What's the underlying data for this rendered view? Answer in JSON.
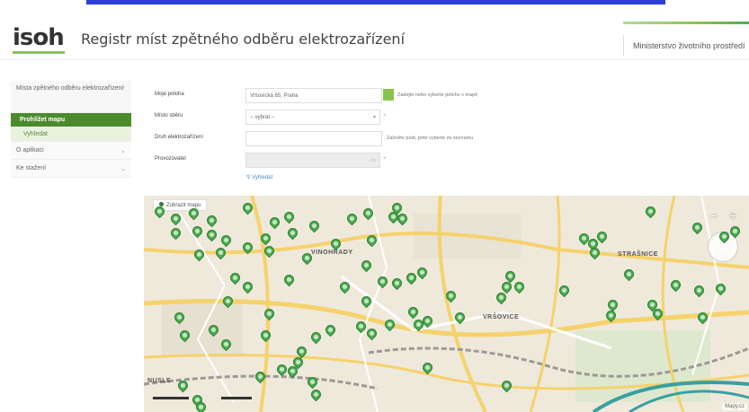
{
  "header": {
    "logo": "isoh",
    "title": "Registr míst zpětného odběru elektrozařízení",
    "ministry": "Ministerstvo životního prostředí"
  },
  "sidebar": {
    "group_label": "Místa zpětného odběru elektrozařízení",
    "active_item": "Prohlížet mapu",
    "sub_item": "Vyhledat",
    "item_2": "O aplikaci",
    "item_3": "Ke stažení"
  },
  "form": {
    "place_label": "Moje poloha",
    "place_value": "Vršovická 65, Praha",
    "place_help": "Zadejte nebo vyberte polohu v mapě",
    "type_label": "Místo sběru",
    "type_value": "-- vybrat --",
    "kind_label": "Druh elektrozařízení",
    "kind_value": "",
    "kind_help": "Začněte psát, poté vyberte ze seznamu",
    "operator_label": "Provozovatel",
    "operator_value": "",
    "search_link": "Vyhledat"
  },
  "map": {
    "tab_label": "Zobrazit mapu",
    "labels": {
      "vinohrady": "VINOHRADY",
      "strasnice": "STRAŠNICE",
      "vrsovice": "VRŠOVICE",
      "nusle": "NUSLE"
    },
    "zoom_out": "−",
    "zoom_in": "+",
    "attribution": "Mapy.cz"
  },
  "colors": {
    "accent_green": "#8bc34a",
    "dark_green": "#4c8a2e",
    "pin_green": "#4caf50",
    "top_bar_blue": "#2f3fd6"
  }
}
